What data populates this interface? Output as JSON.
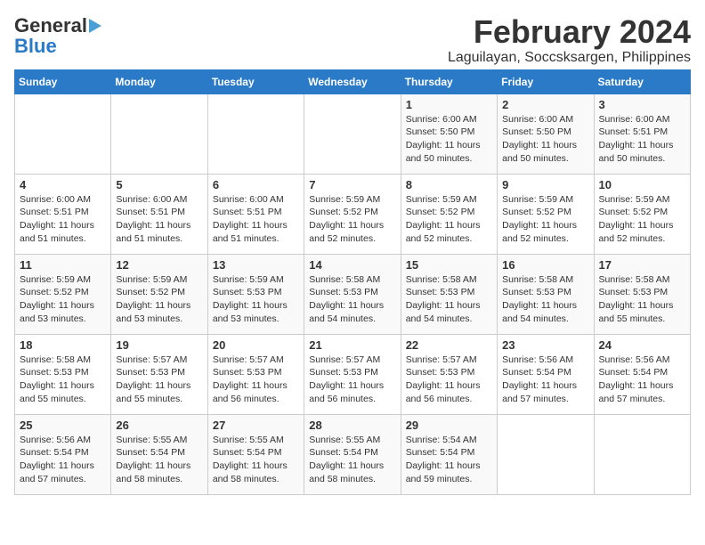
{
  "header": {
    "logo_line1": "General",
    "logo_line2": "Blue",
    "title": "February 2024",
    "subtitle": "Laguilayan, Soccsksargen, Philippines"
  },
  "days_of_week": [
    "Sunday",
    "Monday",
    "Tuesday",
    "Wednesday",
    "Thursday",
    "Friday",
    "Saturday"
  ],
  "weeks": [
    [
      {
        "day": "",
        "detail": ""
      },
      {
        "day": "",
        "detail": ""
      },
      {
        "day": "",
        "detail": ""
      },
      {
        "day": "",
        "detail": ""
      },
      {
        "day": "1",
        "detail": "Sunrise: 6:00 AM\nSunset: 5:50 PM\nDaylight: 11 hours\nand 50 minutes."
      },
      {
        "day": "2",
        "detail": "Sunrise: 6:00 AM\nSunset: 5:50 PM\nDaylight: 11 hours\nand 50 minutes."
      },
      {
        "day": "3",
        "detail": "Sunrise: 6:00 AM\nSunset: 5:51 PM\nDaylight: 11 hours\nand 50 minutes."
      }
    ],
    [
      {
        "day": "4",
        "detail": "Sunrise: 6:00 AM\nSunset: 5:51 PM\nDaylight: 11 hours\nand 51 minutes."
      },
      {
        "day": "5",
        "detail": "Sunrise: 6:00 AM\nSunset: 5:51 PM\nDaylight: 11 hours\nand 51 minutes."
      },
      {
        "day": "6",
        "detail": "Sunrise: 6:00 AM\nSunset: 5:51 PM\nDaylight: 11 hours\nand 51 minutes."
      },
      {
        "day": "7",
        "detail": "Sunrise: 5:59 AM\nSunset: 5:52 PM\nDaylight: 11 hours\nand 52 minutes."
      },
      {
        "day": "8",
        "detail": "Sunrise: 5:59 AM\nSunset: 5:52 PM\nDaylight: 11 hours\nand 52 minutes."
      },
      {
        "day": "9",
        "detail": "Sunrise: 5:59 AM\nSunset: 5:52 PM\nDaylight: 11 hours\nand 52 minutes."
      },
      {
        "day": "10",
        "detail": "Sunrise: 5:59 AM\nSunset: 5:52 PM\nDaylight: 11 hours\nand 52 minutes."
      }
    ],
    [
      {
        "day": "11",
        "detail": "Sunrise: 5:59 AM\nSunset: 5:52 PM\nDaylight: 11 hours\nand 53 minutes."
      },
      {
        "day": "12",
        "detail": "Sunrise: 5:59 AM\nSunset: 5:52 PM\nDaylight: 11 hours\nand 53 minutes."
      },
      {
        "day": "13",
        "detail": "Sunrise: 5:59 AM\nSunset: 5:53 PM\nDaylight: 11 hours\nand 53 minutes."
      },
      {
        "day": "14",
        "detail": "Sunrise: 5:58 AM\nSunset: 5:53 PM\nDaylight: 11 hours\nand 54 minutes."
      },
      {
        "day": "15",
        "detail": "Sunrise: 5:58 AM\nSunset: 5:53 PM\nDaylight: 11 hours\nand 54 minutes."
      },
      {
        "day": "16",
        "detail": "Sunrise: 5:58 AM\nSunset: 5:53 PM\nDaylight: 11 hours\nand 54 minutes."
      },
      {
        "day": "17",
        "detail": "Sunrise: 5:58 AM\nSunset: 5:53 PM\nDaylight: 11 hours\nand 55 minutes."
      }
    ],
    [
      {
        "day": "18",
        "detail": "Sunrise: 5:58 AM\nSunset: 5:53 PM\nDaylight: 11 hours\nand 55 minutes."
      },
      {
        "day": "19",
        "detail": "Sunrise: 5:57 AM\nSunset: 5:53 PM\nDaylight: 11 hours\nand 55 minutes."
      },
      {
        "day": "20",
        "detail": "Sunrise: 5:57 AM\nSunset: 5:53 PM\nDaylight: 11 hours\nand 56 minutes."
      },
      {
        "day": "21",
        "detail": "Sunrise: 5:57 AM\nSunset: 5:53 PM\nDaylight: 11 hours\nand 56 minutes."
      },
      {
        "day": "22",
        "detail": "Sunrise: 5:57 AM\nSunset: 5:53 PM\nDaylight: 11 hours\nand 56 minutes."
      },
      {
        "day": "23",
        "detail": "Sunrise: 5:56 AM\nSunset: 5:54 PM\nDaylight: 11 hours\nand 57 minutes."
      },
      {
        "day": "24",
        "detail": "Sunrise: 5:56 AM\nSunset: 5:54 PM\nDaylight: 11 hours\nand 57 minutes."
      }
    ],
    [
      {
        "day": "25",
        "detail": "Sunrise: 5:56 AM\nSunset: 5:54 PM\nDaylight: 11 hours\nand 57 minutes."
      },
      {
        "day": "26",
        "detail": "Sunrise: 5:55 AM\nSunset: 5:54 PM\nDaylight: 11 hours\nand 58 minutes."
      },
      {
        "day": "27",
        "detail": "Sunrise: 5:55 AM\nSunset: 5:54 PM\nDaylight: 11 hours\nand 58 minutes."
      },
      {
        "day": "28",
        "detail": "Sunrise: 5:55 AM\nSunset: 5:54 PM\nDaylight: 11 hours\nand 58 minutes."
      },
      {
        "day": "29",
        "detail": "Sunrise: 5:54 AM\nSunset: 5:54 PM\nDaylight: 11 hours\nand 59 minutes."
      },
      {
        "day": "",
        "detail": ""
      },
      {
        "day": "",
        "detail": ""
      }
    ]
  ]
}
